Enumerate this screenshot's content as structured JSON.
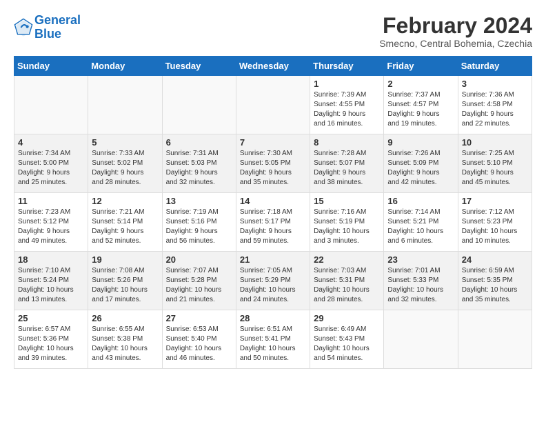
{
  "header": {
    "logo_line1": "General",
    "logo_line2": "Blue",
    "month": "February 2024",
    "location": "Smecno, Central Bohemia, Czechia"
  },
  "days_of_week": [
    "Sunday",
    "Monday",
    "Tuesday",
    "Wednesday",
    "Thursday",
    "Friday",
    "Saturday"
  ],
  "weeks": [
    [
      {
        "day": "",
        "info": ""
      },
      {
        "day": "",
        "info": ""
      },
      {
        "day": "",
        "info": ""
      },
      {
        "day": "",
        "info": ""
      },
      {
        "day": "1",
        "info": "Sunrise: 7:39 AM\nSunset: 4:55 PM\nDaylight: 9 hours\nand 16 minutes."
      },
      {
        "day": "2",
        "info": "Sunrise: 7:37 AM\nSunset: 4:57 PM\nDaylight: 9 hours\nand 19 minutes."
      },
      {
        "day": "3",
        "info": "Sunrise: 7:36 AM\nSunset: 4:58 PM\nDaylight: 9 hours\nand 22 minutes."
      }
    ],
    [
      {
        "day": "4",
        "info": "Sunrise: 7:34 AM\nSunset: 5:00 PM\nDaylight: 9 hours\nand 25 minutes."
      },
      {
        "day": "5",
        "info": "Sunrise: 7:33 AM\nSunset: 5:02 PM\nDaylight: 9 hours\nand 28 minutes."
      },
      {
        "day": "6",
        "info": "Sunrise: 7:31 AM\nSunset: 5:03 PM\nDaylight: 9 hours\nand 32 minutes."
      },
      {
        "day": "7",
        "info": "Sunrise: 7:30 AM\nSunset: 5:05 PM\nDaylight: 9 hours\nand 35 minutes."
      },
      {
        "day": "8",
        "info": "Sunrise: 7:28 AM\nSunset: 5:07 PM\nDaylight: 9 hours\nand 38 minutes."
      },
      {
        "day": "9",
        "info": "Sunrise: 7:26 AM\nSunset: 5:09 PM\nDaylight: 9 hours\nand 42 minutes."
      },
      {
        "day": "10",
        "info": "Sunrise: 7:25 AM\nSunset: 5:10 PM\nDaylight: 9 hours\nand 45 minutes."
      }
    ],
    [
      {
        "day": "11",
        "info": "Sunrise: 7:23 AM\nSunset: 5:12 PM\nDaylight: 9 hours\nand 49 minutes."
      },
      {
        "day": "12",
        "info": "Sunrise: 7:21 AM\nSunset: 5:14 PM\nDaylight: 9 hours\nand 52 minutes."
      },
      {
        "day": "13",
        "info": "Sunrise: 7:19 AM\nSunset: 5:16 PM\nDaylight: 9 hours\nand 56 minutes."
      },
      {
        "day": "14",
        "info": "Sunrise: 7:18 AM\nSunset: 5:17 PM\nDaylight: 9 hours\nand 59 minutes."
      },
      {
        "day": "15",
        "info": "Sunrise: 7:16 AM\nSunset: 5:19 PM\nDaylight: 10 hours\nand 3 minutes."
      },
      {
        "day": "16",
        "info": "Sunrise: 7:14 AM\nSunset: 5:21 PM\nDaylight: 10 hours\nand 6 minutes."
      },
      {
        "day": "17",
        "info": "Sunrise: 7:12 AM\nSunset: 5:23 PM\nDaylight: 10 hours\nand 10 minutes."
      }
    ],
    [
      {
        "day": "18",
        "info": "Sunrise: 7:10 AM\nSunset: 5:24 PM\nDaylight: 10 hours\nand 13 minutes."
      },
      {
        "day": "19",
        "info": "Sunrise: 7:08 AM\nSunset: 5:26 PM\nDaylight: 10 hours\nand 17 minutes."
      },
      {
        "day": "20",
        "info": "Sunrise: 7:07 AM\nSunset: 5:28 PM\nDaylight: 10 hours\nand 21 minutes."
      },
      {
        "day": "21",
        "info": "Sunrise: 7:05 AM\nSunset: 5:29 PM\nDaylight: 10 hours\nand 24 minutes."
      },
      {
        "day": "22",
        "info": "Sunrise: 7:03 AM\nSunset: 5:31 PM\nDaylight: 10 hours\nand 28 minutes."
      },
      {
        "day": "23",
        "info": "Sunrise: 7:01 AM\nSunset: 5:33 PM\nDaylight: 10 hours\nand 32 minutes."
      },
      {
        "day": "24",
        "info": "Sunrise: 6:59 AM\nSunset: 5:35 PM\nDaylight: 10 hours\nand 35 minutes."
      }
    ],
    [
      {
        "day": "25",
        "info": "Sunrise: 6:57 AM\nSunset: 5:36 PM\nDaylight: 10 hours\nand 39 minutes."
      },
      {
        "day": "26",
        "info": "Sunrise: 6:55 AM\nSunset: 5:38 PM\nDaylight: 10 hours\nand 43 minutes."
      },
      {
        "day": "27",
        "info": "Sunrise: 6:53 AM\nSunset: 5:40 PM\nDaylight: 10 hours\nand 46 minutes."
      },
      {
        "day": "28",
        "info": "Sunrise: 6:51 AM\nSunset: 5:41 PM\nDaylight: 10 hours\nand 50 minutes."
      },
      {
        "day": "29",
        "info": "Sunrise: 6:49 AM\nSunset: 5:43 PM\nDaylight: 10 hours\nand 54 minutes."
      },
      {
        "day": "",
        "info": ""
      },
      {
        "day": "",
        "info": ""
      }
    ]
  ]
}
